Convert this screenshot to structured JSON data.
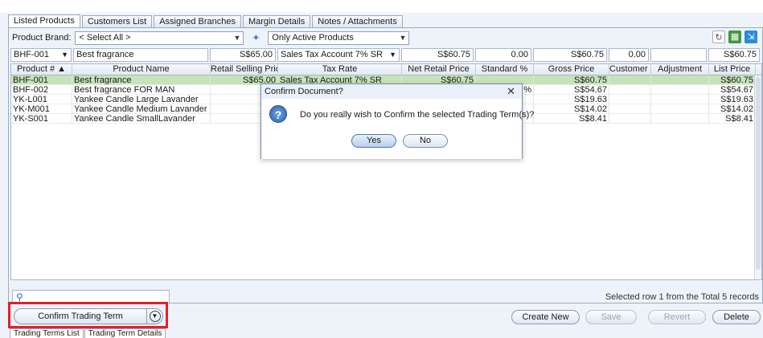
{
  "tabs": [
    "Listed Products",
    "Customers List",
    "Assigned Branches",
    "Margin Details",
    "Notes / Attachments"
  ],
  "filter": {
    "brand_label": "Product Brand:",
    "brand_value": "< Select All >",
    "status_value": "Only Active Products"
  },
  "edit_row": {
    "product_no": "BHF-001",
    "product_name": "Best fragrance",
    "retail_price": "S$65.00",
    "tax_rate": "Sales Tax Account 7% SR",
    "net_retail": "S$60.75",
    "standard_pct": "0.00",
    "gross_price": "S$60.75",
    "customer_pct": "0.00",
    "adjustment": "",
    "list_price": "S$60.75"
  },
  "grid": {
    "headers": [
      "Product # ▲",
      "Product Name",
      "Retail Selling Price",
      "Tax Rate",
      "Net Retail Price",
      "Standard %",
      "Gross Price",
      "Customer %",
      "Adjustment",
      "List Price"
    ],
    "rows": [
      {
        "no": "BHF-001",
        "name": "Best fragrance",
        "retail": "S$65.00",
        "tax": "Sales Tax Account 7% SR",
        "net": "S$60.75",
        "std": "",
        "gross": "S$60.75",
        "cust": "",
        "adj": "",
        "list": "S$60.75"
      },
      {
        "no": "BHF-002",
        "name": "Best fragrance FOR MAN",
        "retail": "",
        "tax": "",
        "net": "",
        "std": "%",
        "gross": "S$54.67",
        "cust": "",
        "adj": "",
        "list": "S$54.67"
      },
      {
        "no": "YK-L001",
        "name": "Yankee Candle Large Lavander",
        "retail": "",
        "tax": "",
        "net": "",
        "std": "",
        "gross": "S$19.63",
        "cust": "",
        "adj": "",
        "list": "S$19.63"
      },
      {
        "no": "YK-M001",
        "name": "Yankee Candle Medium Lavander",
        "retail": "",
        "tax": "",
        "net": "",
        "std": "",
        "gross": "S$14.02",
        "cust": "",
        "adj": "",
        "list": "S$14.02"
      },
      {
        "no": "YK-S001",
        "name": "Yankee Candle SmallLavander",
        "retail": "",
        "tax": "",
        "net": "",
        "std": "",
        "gross": "S$8.41",
        "cust": "",
        "adj": "",
        "list": "S$8.41"
      }
    ]
  },
  "status_text": "Selected row 1 from the Total 5 records",
  "actions": {
    "confirm": "Confirm Trading Term",
    "create_new": "Create New",
    "save": "Save",
    "revert": "Revert",
    "delete": "Delete"
  },
  "bottom_tabs": [
    "Trading Terms List",
    "Trading Term Details"
  ],
  "dialog": {
    "title": "Confirm Document?",
    "message": "Do you really wish to Confirm the selected Trading Term(s)?",
    "yes": "Yes",
    "no": "No",
    "close": "✕"
  }
}
